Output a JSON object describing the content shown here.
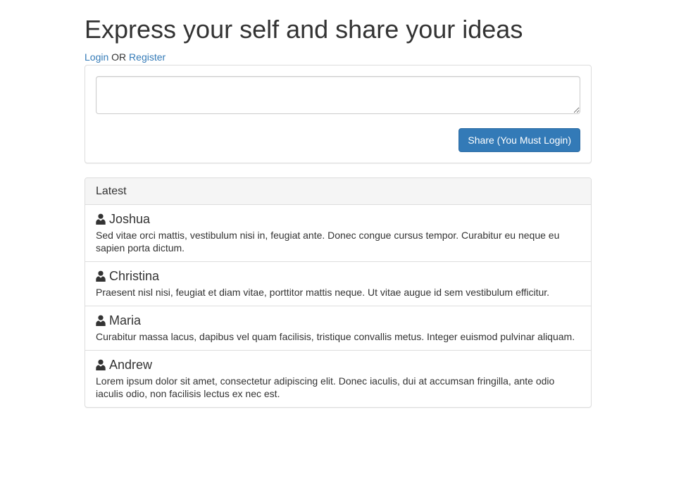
{
  "header": {
    "title": "Express your self and share your ideas",
    "login_label": "Login",
    "or_label": "OR",
    "register_label": "Register"
  },
  "compose": {
    "textarea_value": "",
    "share_label": "Share (You Must Login)"
  },
  "latest": {
    "heading": "Latest",
    "posts": [
      {
        "author": "Joshua",
        "icon": "user-icon",
        "text": "Sed vitae orci mattis, vestibulum nisi in, feugiat ante. Donec congue cursus tempor. Curabitur eu neque eu sapien porta dictum."
      },
      {
        "author": "Christina",
        "icon": "user-icon",
        "text": "Praesent nisl nisi, feugiat et diam vitae, porttitor mattis neque. Ut vitae augue id sem vestibulum efficitur."
      },
      {
        "author": "Maria",
        "icon": "user-icon",
        "text": "Curabitur massa lacus, dapibus vel quam facilisis, tristique convallis metus. Integer euismod pulvinar aliquam."
      },
      {
        "author": "Andrew",
        "icon": "user-icon",
        "text": "Lorem ipsum dolor sit amet, consectetur adipiscing elit. Donec iaculis, dui at accumsan fringilla, ante odio iaculis odio, non facilisis lectus ex nec est."
      }
    ]
  },
  "colors": {
    "link": "#337ab7",
    "primary_button": "#337ab7",
    "panel_border": "#dddddd",
    "panel_heading_bg": "#f5f5f5",
    "text": "#333333"
  }
}
